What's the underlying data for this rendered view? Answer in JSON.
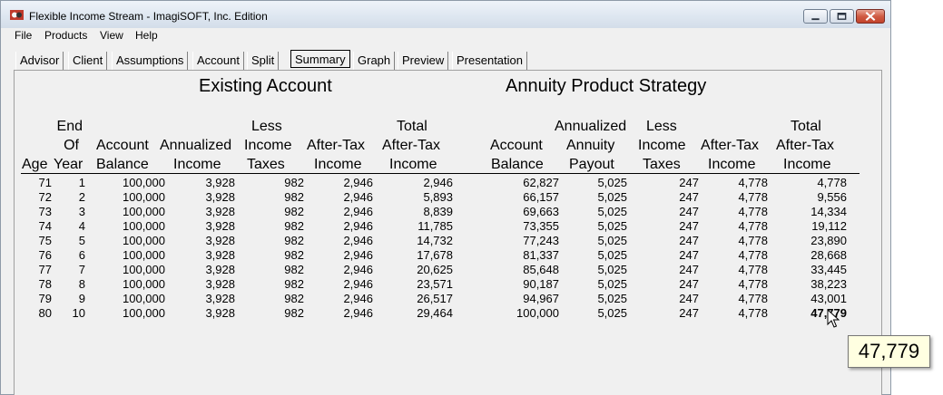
{
  "window": {
    "title": "Flexible Income Stream - ImagiSOFT, Inc. Edition"
  },
  "menu": [
    "File",
    "Products",
    "View",
    "Help"
  ],
  "tabs": [
    "Advisor",
    "Client",
    "Assumptions",
    "Account",
    "Split",
    "Summary",
    "Graph",
    "Preview",
    "Presentation"
  ],
  "active_tab": "Summary",
  "sections": {
    "existing": "Existing Account",
    "annuity": "Annuity Product Strategy"
  },
  "headers": {
    "age": "Age",
    "end_of_year": [
      "End",
      "Of",
      "Year"
    ],
    "account_balance": [
      "Account",
      "Balance"
    ],
    "annualized_income": [
      "Annualized",
      "Income"
    ],
    "less_income_taxes": [
      "Less",
      "Income",
      "Taxes"
    ],
    "after_tax_income": [
      "After-Tax",
      "Income"
    ],
    "total_after_tax_income": [
      "Total",
      "After-Tax",
      "Income"
    ],
    "annuity_account_balance": [
      "Account",
      "Balance"
    ],
    "annualized_annuity_payout": [
      "Annualized",
      "Annuity",
      "Payout"
    ],
    "annuity_less_income_taxes": [
      "Less",
      "Income",
      "Taxes"
    ],
    "annuity_after_tax_income": [
      "After-Tax",
      "Income"
    ],
    "annuity_total_after_tax_income": [
      "Total",
      "After-Tax",
      "Income"
    ]
  },
  "rows": [
    [
      "71",
      "1",
      "100,000",
      "3,928",
      "982",
      "2,946",
      "2,946",
      "62,827",
      "5,025",
      "247",
      "4,778",
      "4,778"
    ],
    [
      "72",
      "2",
      "100,000",
      "3,928",
      "982",
      "2,946",
      "5,893",
      "66,157",
      "5,025",
      "247",
      "4,778",
      "9,556"
    ],
    [
      "73",
      "3",
      "100,000",
      "3,928",
      "982",
      "2,946",
      "8,839",
      "69,663",
      "5,025",
      "247",
      "4,778",
      "14,334"
    ],
    [
      "74",
      "4",
      "100,000",
      "3,928",
      "982",
      "2,946",
      "11,785",
      "73,355",
      "5,025",
      "247",
      "4,778",
      "19,112"
    ],
    [
      "75",
      "5",
      "100,000",
      "3,928",
      "982",
      "2,946",
      "14,732",
      "77,243",
      "5,025",
      "247",
      "4,778",
      "23,890"
    ],
    [
      "76",
      "6",
      "100,000",
      "3,928",
      "982",
      "2,946",
      "17,678",
      "81,337",
      "5,025",
      "247",
      "4,778",
      "28,668"
    ],
    [
      "77",
      "7",
      "100,000",
      "3,928",
      "982",
      "2,946",
      "20,625",
      "85,648",
      "5,025",
      "247",
      "4,778",
      "33,445"
    ],
    [
      "78",
      "8",
      "100,000",
      "3,928",
      "982",
      "2,946",
      "23,571",
      "90,187",
      "5,025",
      "247",
      "4,778",
      "38,223"
    ],
    [
      "79",
      "9",
      "100,000",
      "3,928",
      "982",
      "2,946",
      "26,517",
      "94,967",
      "5,025",
      "247",
      "4,778",
      "43,001"
    ],
    [
      "80",
      "10",
      "100,000",
      "3,928",
      "982",
      "2,946",
      "29,464",
      "100,000",
      "5,025",
      "247",
      "4,778",
      "47,779"
    ]
  ],
  "tooltip": "47,779",
  "icons": {
    "app": "app-icon",
    "minimize": "minimize-icon",
    "maximize": "maximize-icon",
    "close": "close-icon",
    "cursor": "mouse-cursor-icon"
  }
}
